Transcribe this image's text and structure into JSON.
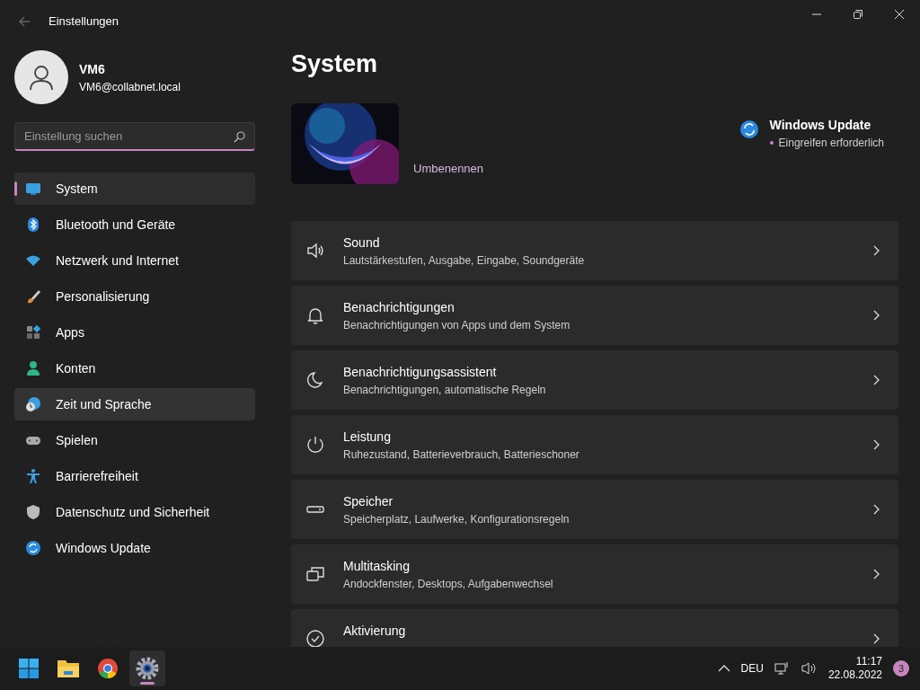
{
  "window": {
    "title": "Einstellungen"
  },
  "user": {
    "name": "VM6",
    "email": "VM6@collabnet.local"
  },
  "search": {
    "placeholder": "Einstellung suchen"
  },
  "sidebar": {
    "items": [
      {
        "label": "System",
        "selected": true,
        "hovered": false
      },
      {
        "label": "Bluetooth und Geräte",
        "selected": false,
        "hovered": false
      },
      {
        "label": "Netzwerk und Internet",
        "selected": false,
        "hovered": false
      },
      {
        "label": "Personalisierung",
        "selected": false,
        "hovered": false
      },
      {
        "label": "Apps",
        "selected": false,
        "hovered": false
      },
      {
        "label": "Konten",
        "selected": false,
        "hovered": false
      },
      {
        "label": "Zeit und Sprache",
        "selected": false,
        "hovered": true
      },
      {
        "label": "Spielen",
        "selected": false,
        "hovered": false
      },
      {
        "label": "Barrierefreiheit",
        "selected": false,
        "hovered": false
      },
      {
        "label": "Datenschutz und Sicherheit",
        "selected": false,
        "hovered": false
      },
      {
        "label": "Windows Update",
        "selected": false,
        "hovered": false
      }
    ]
  },
  "page": {
    "title": "System",
    "rename": "Umbenennen",
    "update": {
      "title": "Windows Update",
      "status": "Eingreifen erforderlich",
      "color": "#c586c0"
    },
    "cards": [
      {
        "title": "Sound",
        "subtitle": "Lautstärkestufen, Ausgabe, Eingabe, Soundgeräte"
      },
      {
        "title": "Benachrichtigungen",
        "subtitle": "Benachrichtigungen von Apps und dem System"
      },
      {
        "title": "Benachrichtigungsassistent",
        "subtitle": "Benachrichtigungen, automatische Regeln"
      },
      {
        "title": "Leistung",
        "subtitle": "Ruhezustand, Batterieverbrauch, Batterieschoner"
      },
      {
        "title": "Speicher",
        "subtitle": "Speicherplatz, Laufwerke, Konfigurationsregeln"
      },
      {
        "title": "Multitasking",
        "subtitle": "Andockfenster, Desktops, Aufgabenwechsel"
      },
      {
        "title": "Aktivierung"
      }
    ]
  },
  "taskbar": {
    "apps": [
      {
        "active": false
      },
      {
        "active": false
      },
      {
        "active": false
      },
      {
        "active": true
      }
    ],
    "language": "DEU",
    "time": "11:17",
    "date": "22.08.2022",
    "badge": "3"
  }
}
